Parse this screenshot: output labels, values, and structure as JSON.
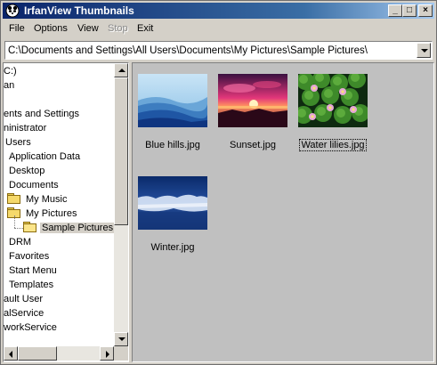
{
  "window": {
    "title": "IrfanView Thumbnails"
  },
  "title_buttons": {
    "minimize": "_",
    "maximize": "□",
    "close": "×"
  },
  "menu": {
    "items": [
      "File",
      "Options",
      "View",
      "Stop",
      "Exit"
    ],
    "disabled": [
      "Stop"
    ]
  },
  "path": {
    "value": "C:\\Documents and Settings\\All Users\\Documents\\My Pictures\\Sample Pictures\\"
  },
  "tree": {
    "items": [
      {
        "label": "C:)"
      },
      {
        "label": "an"
      },
      {
        "label": "ents and Settings"
      },
      {
        "label": "ninistrator"
      },
      {
        "label": "Users"
      },
      {
        "label": "Application Data"
      },
      {
        "label": "Desktop"
      },
      {
        "label": "Documents"
      },
      {
        "label": "My Music",
        "icon": "folder-icon"
      },
      {
        "label": "My Pictures",
        "icon": "folder-icon"
      },
      {
        "label": "Sample Pictures",
        "icon": "folder-open-icon",
        "selected": true
      },
      {
        "label": "DRM"
      },
      {
        "label": "Favorites"
      },
      {
        "label": "Start Menu"
      },
      {
        "label": "Templates"
      },
      {
        "label": "ault User"
      },
      {
        "label": "alService"
      },
      {
        "label": "workService"
      }
    ]
  },
  "thumbnails": {
    "items": [
      {
        "name": "Blue hills.jpg",
        "picture": "blue-hills"
      },
      {
        "name": "Sunset.jpg",
        "picture": "sunset"
      },
      {
        "name": "Water lilies.jpg",
        "picture": "water-lilies",
        "focused": true
      },
      {
        "name": "Winter.jpg",
        "picture": "winter"
      }
    ]
  },
  "colors": {
    "title_start": "#0a246a",
    "title_end": "#a6caf0",
    "face": "#d4d0c8",
    "thumb_bg": "#c0c0c0"
  }
}
